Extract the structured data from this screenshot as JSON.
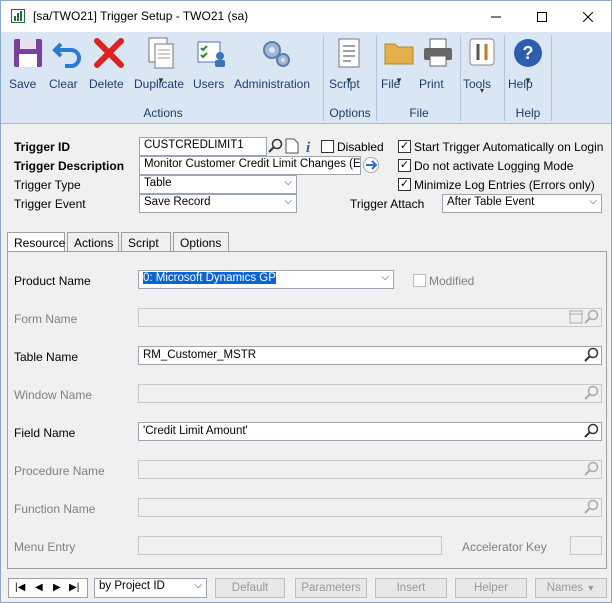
{
  "window": {
    "title": "[sa/TWO21] Trigger Setup  -  TWO21 (sa)"
  },
  "ribbon": {
    "buttons": [
      {
        "label": "Save",
        "icon": "floppy-disk-icon"
      },
      {
        "label": "Clear",
        "icon": "undo-arrow-icon"
      },
      {
        "label": "Delete",
        "icon": "red-x-icon"
      },
      {
        "label": "Duplicate",
        "icon": "duplicate-pages-icon"
      },
      {
        "label": "Users",
        "icon": "users-checklist-icon"
      },
      {
        "label": "Administration",
        "icon": "gears-icon"
      },
      {
        "label": "Script",
        "icon": "script-document-icon"
      },
      {
        "label": "File",
        "icon": "folder-icon"
      },
      {
        "label": "Print",
        "icon": "printer-icon"
      },
      {
        "label": "Tools",
        "icon": "tools-icon"
      },
      {
        "label": "Help",
        "icon": "help-question-icon"
      }
    ],
    "groups": {
      "actions": "Actions",
      "options": "Options",
      "file": "File",
      "help": "Help"
    }
  },
  "header": {
    "trigger_id_label": "Trigger ID",
    "trigger_id_value": "CUSTCREDLIMIT1",
    "disabled_label": "Disabled",
    "trigger_description_label": "Trigger Description",
    "trigger_description_value": "Monitor Customer Credit Limit Changes (Email)",
    "trigger_type_label": "Trigger Type",
    "trigger_type_value": "Table",
    "trigger_event_label": "Trigger Event",
    "trigger_event_value": "Save Record",
    "trigger_attach_label": "Trigger Attach",
    "trigger_attach_value": "After Table Event",
    "start_auto_label": "Start Trigger Automatically on Login",
    "no_logging_label": "Do not activate Logging Mode",
    "minimize_log_label": "Minimize Log Entries (Errors only)"
  },
  "tabs": [
    "Resource",
    "Actions",
    "Script",
    "Options"
  ],
  "resource": {
    "product_name_label": "Product Name",
    "product_name_value": "0: Microsoft Dynamics GP",
    "modified_label": "Modified",
    "form_name_label": "Form Name",
    "table_name_label": "Table Name",
    "table_name_value": "RM_Customer_MSTR",
    "window_name_label": "Window Name",
    "field_name_label": "Field Name",
    "field_name_value": "'Credit Limit Amount'",
    "procedure_name_label": "Procedure Name",
    "function_name_label": "Function Name",
    "menu_entry_label": "Menu Entry",
    "accelerator_key_label": "Accelerator Key"
  },
  "bottom": {
    "sort_value": "by Project ID",
    "buttons": [
      "Default",
      "Parameters",
      "Insert",
      "Helper",
      "Names"
    ]
  },
  "colors": {
    "ribbon_bg": "#dbe6f4",
    "ribbon_text": "#1b3d6e",
    "selection": "#0a64d7"
  }
}
